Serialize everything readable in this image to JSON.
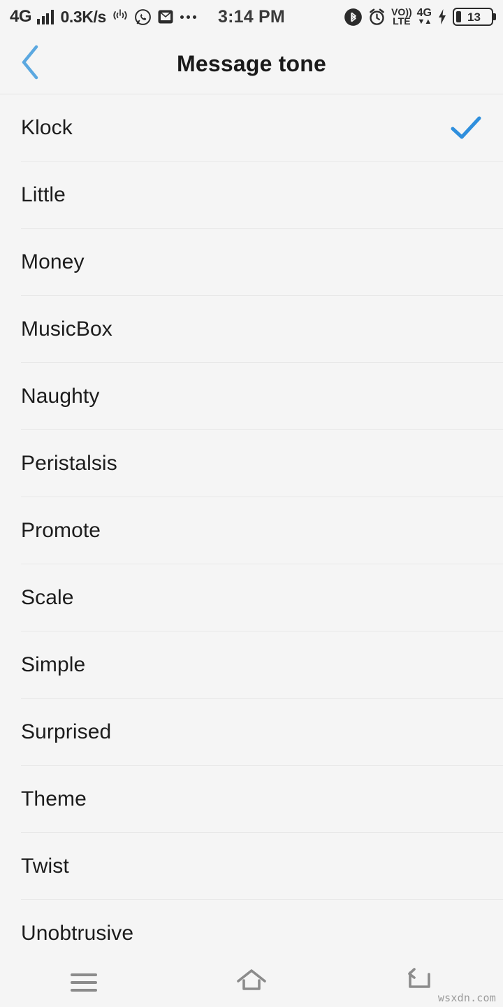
{
  "status_bar": {
    "network_label": "4G",
    "signal_icon": "signal-bars-icon",
    "data_speed": "0.3K/s",
    "hotspot_icon": "hotspot-icon",
    "whatsapp_icon": "whatsapp-icon",
    "mail_icon": "mail-icon",
    "more_icon": "more-dots-icon",
    "time": "3:14 PM",
    "bluetooth_icon": "bluetooth-icon",
    "alarm_icon": "alarm-clock-icon",
    "volte_top": "VO))",
    "volte_bottom": "LTE",
    "network_type": "4G",
    "data_arrows": "▼▲",
    "charging_icon": "charging-bolt-icon",
    "battery_level": "13"
  },
  "header": {
    "back_icon": "back-chevron-icon",
    "title": "Message tone",
    "back_color": "#5ba8e0"
  },
  "list": {
    "selected": "Klock",
    "check_icon": "checkmark-icon",
    "check_color": "#2f8fdd",
    "items": [
      {
        "label": "Klock",
        "selected": true
      },
      {
        "label": "Little",
        "selected": false
      },
      {
        "label": "Money",
        "selected": false
      },
      {
        "label": "MusicBox",
        "selected": false
      },
      {
        "label": "Naughty",
        "selected": false
      },
      {
        "label": "Peristalsis",
        "selected": false
      },
      {
        "label": "Promote",
        "selected": false
      },
      {
        "label": "Scale",
        "selected": false
      },
      {
        "label": "Simple",
        "selected": false
      },
      {
        "label": "Surprised",
        "selected": false
      },
      {
        "label": "Theme",
        "selected": false
      },
      {
        "label": "Twist",
        "selected": false
      },
      {
        "label": "Unobtrusive",
        "selected": false
      }
    ]
  },
  "nav_bar": {
    "recents_icon": "menu-lines-icon",
    "home_icon": "home-icon",
    "back_icon": "back-arrow-icon",
    "icon_color": "#8b8b8b"
  },
  "watermark": {
    "text": "wsxdn.com"
  }
}
